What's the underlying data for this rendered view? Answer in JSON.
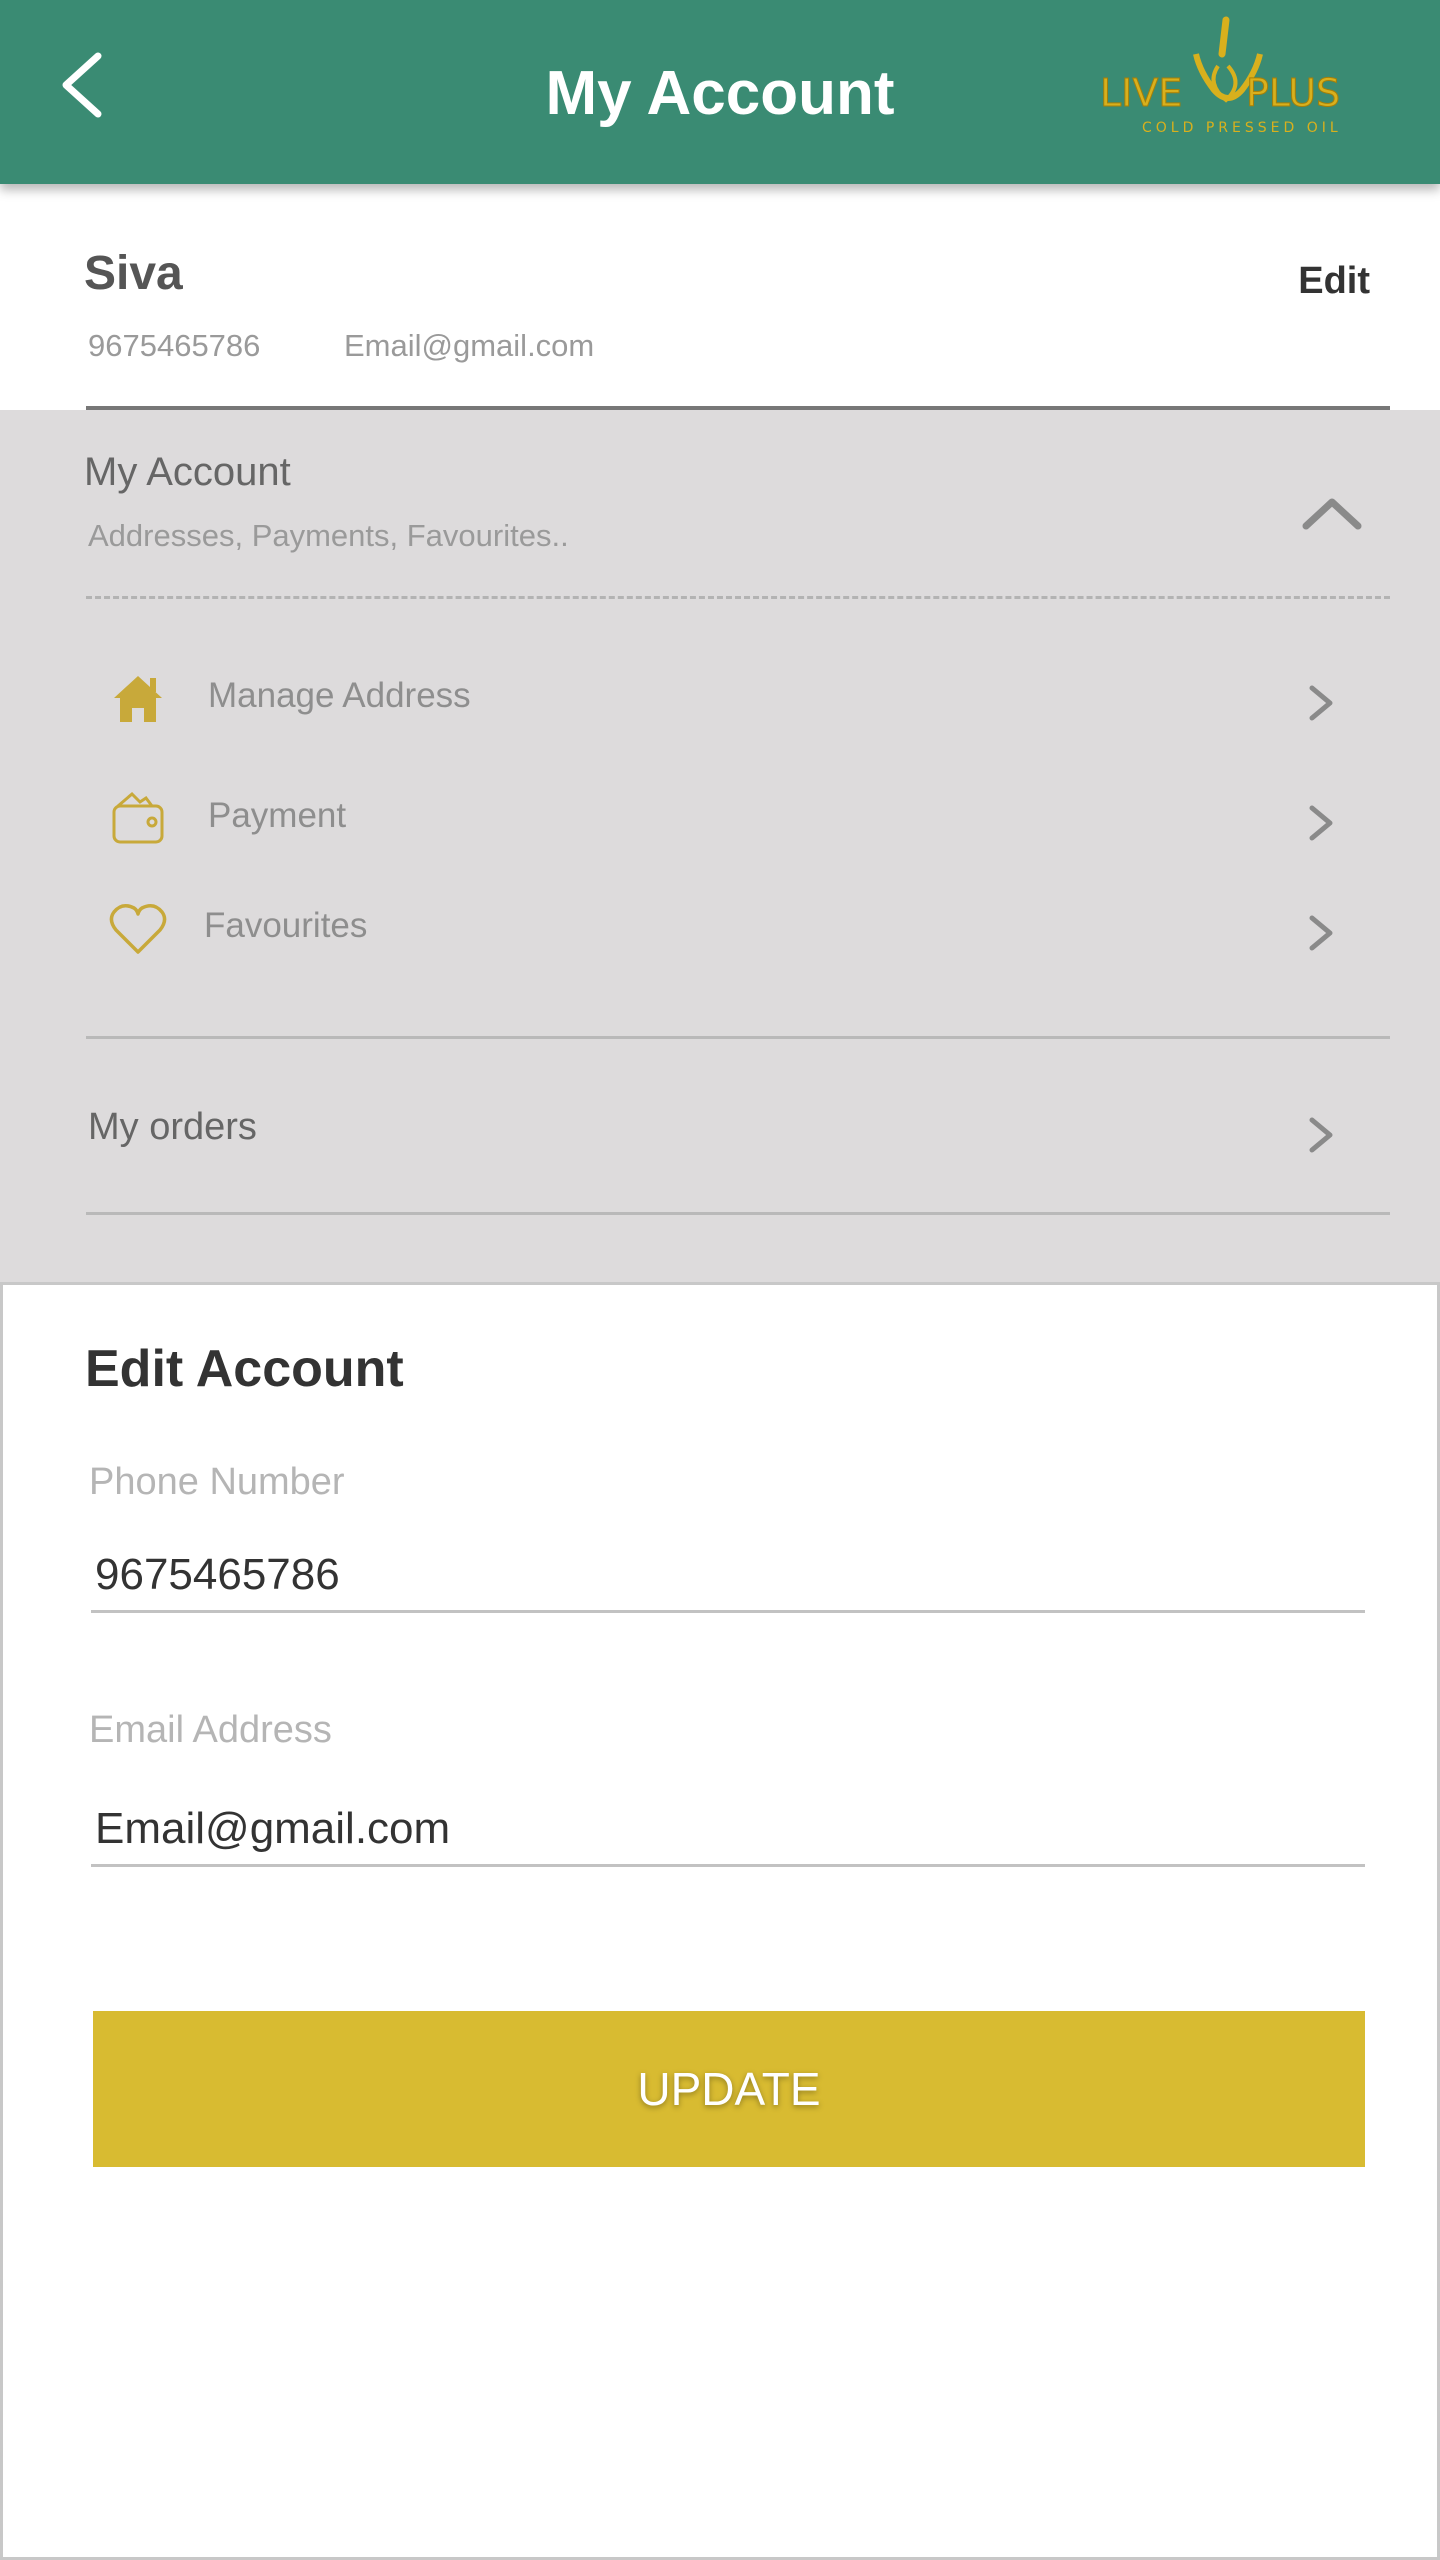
{
  "header": {
    "title": "My Account",
    "back_icon": "chevron-left-icon",
    "logo": {
      "brand_text": "LIVE PLUS",
      "tagline": "COLD PRESSED OIL"
    }
  },
  "profile": {
    "name": "Siva",
    "phone": "9675465786",
    "email": "Email@gmail.com",
    "edit_label": "Edit"
  },
  "account_section": {
    "title": "My Account",
    "subtitle": "Addresses, Payments, Favourites..",
    "expanded": true,
    "items": [
      {
        "label": "Manage Address",
        "icon": "home-icon"
      },
      {
        "label": "Payment",
        "icon": "wallet-icon"
      },
      {
        "label": "Favourites",
        "icon": "heart-icon"
      }
    ]
  },
  "orders": {
    "label": "My orders"
  },
  "edit_account": {
    "title": "Edit Account",
    "phone_label": "Phone Number",
    "phone_value": "9675465786",
    "email_label": "Email Address",
    "email_value": "Email@gmail.com",
    "update_label": "UPDATE"
  },
  "colors": {
    "header": "#3a8b73",
    "accent": "#d8bb31",
    "grey_bg": "#dddbdc"
  }
}
